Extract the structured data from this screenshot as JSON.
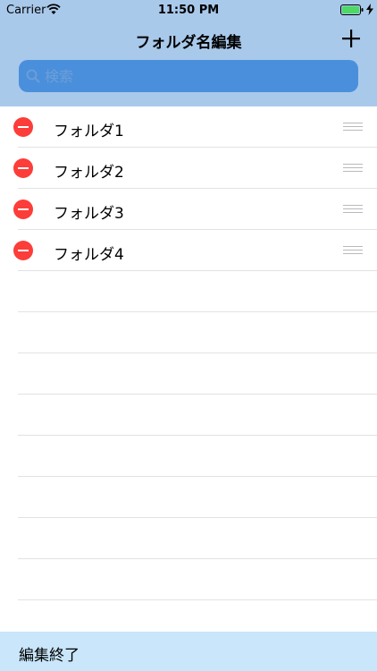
{
  "status_bar": {
    "carrier": "Carrier",
    "time": "11:50 PM",
    "battery_color": "#4cd964"
  },
  "nav": {
    "title": "フォルダ名編集",
    "add_icon": "plus-icon"
  },
  "search": {
    "placeholder": "検索",
    "value": ""
  },
  "folders": [
    {
      "label": "フォルダ1"
    },
    {
      "label": "フォルダ2"
    },
    {
      "label": "フォルダ3"
    },
    {
      "label": "フォルダ4"
    }
  ],
  "toolbar": {
    "done_label": "編集終了"
  },
  "colors": {
    "header_bg": "#a9c9eb",
    "search_bg": "#4a8fdc",
    "delete": "#fc3d39",
    "toolbar_bg": "#c9e6fa"
  }
}
